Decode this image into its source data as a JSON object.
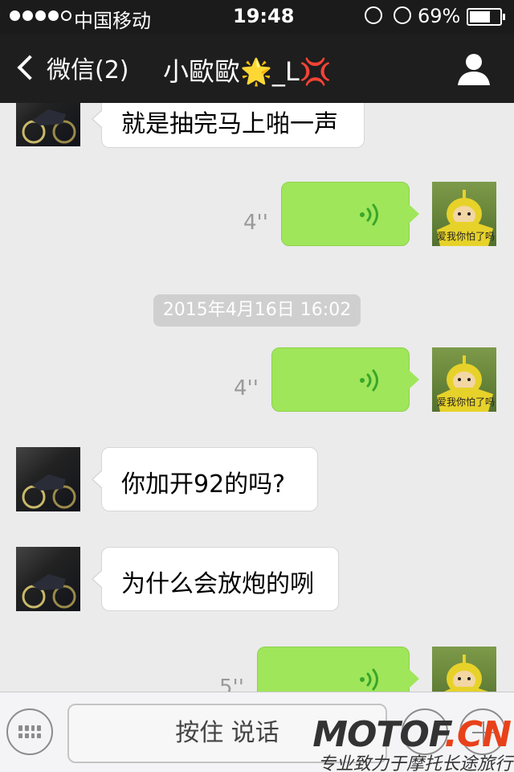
{
  "status_bar": {
    "carrier": "中国移动",
    "time": "19:48",
    "battery_percent": "69%",
    "battery_level": 0.69,
    "signal_bars_filled": 4,
    "icons": [
      "rotation-lock-icon",
      "alarm-icon",
      "battery-icon"
    ]
  },
  "nav": {
    "back_label": "微信(2)",
    "title": "小歐歐🌟_L💢",
    "icons": [
      "back-chevron-icon",
      "profile-icon"
    ]
  },
  "messages": {
    "m1": {
      "sender": "contact",
      "text": "就是抽完马上啪一声"
    },
    "m2": {
      "sender": "me",
      "type": "voice",
      "duration": "4''"
    },
    "timestamp": "2015年4月16日 16:02",
    "m3": {
      "sender": "me",
      "type": "voice",
      "duration": "4''"
    },
    "m4": {
      "sender": "contact",
      "text": "你加开92的吗?"
    },
    "m5": {
      "sender": "contact",
      "text": "为什么会放炮的咧"
    },
    "m6": {
      "sender": "me",
      "type": "voice",
      "duration": "5''"
    }
  },
  "avatar_caption": "爱我你怕了吗",
  "input_bar": {
    "hold_to_talk": "按住 说话",
    "icons": [
      "keyboard-icon",
      "emoji-icon",
      "plus-icon"
    ]
  },
  "watermark": {
    "logo_main": "MOTOF",
    "logo_suffix": ".CN",
    "tagline": "专业致力于摩托长途旅行"
  },
  "colors": {
    "nav_bg": "#1e1e1e",
    "chat_bg": "#ebebeb",
    "outgoing_bubble": "#9fe65a",
    "incoming_bubble": "#ffffff",
    "voice_wave": "#3aa52a",
    "watermark_accent": "#e8411a"
  }
}
